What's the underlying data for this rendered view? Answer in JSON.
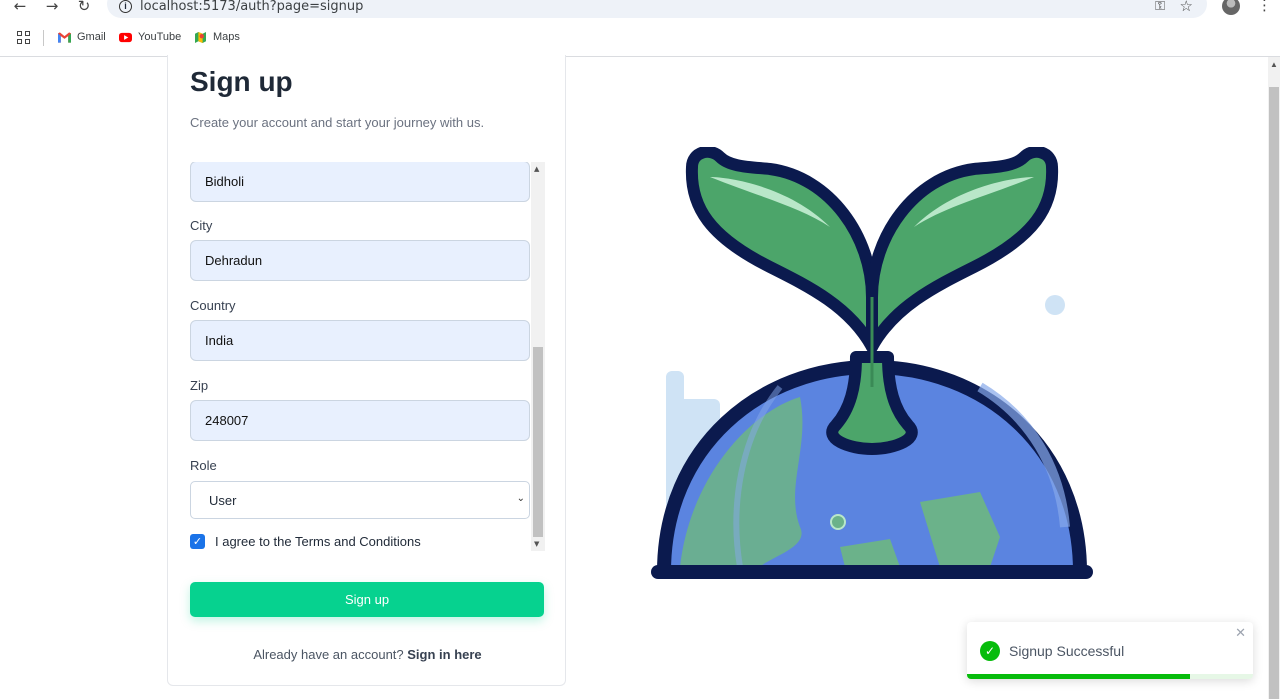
{
  "browser": {
    "url": "localhost:5173/auth?page=signup",
    "bookmarks": [
      {
        "label": "Gmail",
        "icon": "gmail-icon"
      },
      {
        "label": "YouTube",
        "icon": "youtube-icon"
      },
      {
        "label": "Maps",
        "icon": "maps-icon"
      }
    ]
  },
  "signup": {
    "title": "Sign up",
    "subtitle": "Create your account and start your journey with us.",
    "fields": {
      "address2_value": "Bidholi",
      "city_label": "City",
      "city_value": "Dehradun",
      "country_label": "Country",
      "country_value": "India",
      "zip_label": "Zip",
      "zip_value": "248007",
      "role_label": "Role",
      "role_value": "User"
    },
    "terms_label": "I agree to the Terms and Conditions",
    "terms_checked": true,
    "submit_label": "Sign up",
    "footer_prefix": "Already have an account?",
    "footer_link": "Sign in here"
  },
  "toast": {
    "message": "Signup Successful",
    "icon": "check-circle-icon",
    "progress": 0.78
  },
  "colors": {
    "accent": "#06d28f",
    "toast_success": "#07bc0c",
    "input_bg": "#e8f0fe"
  }
}
